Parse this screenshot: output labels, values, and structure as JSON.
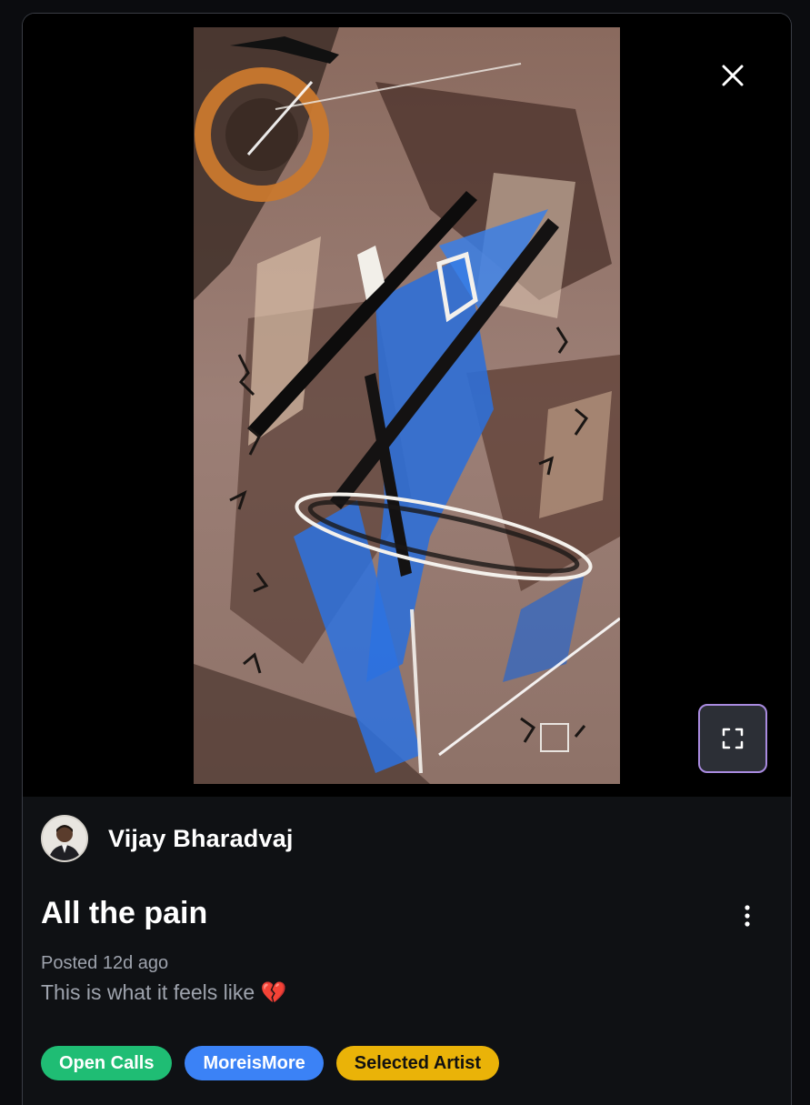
{
  "post": {
    "author_name": "Vijay Bharadvaj",
    "title": "All the pain",
    "posted": "Posted 12d ago",
    "description": "This is what it feels like 💔"
  },
  "icons": {
    "close": "close-icon",
    "expand": "fullscreen-icon",
    "more": "more-vertical-icon",
    "avatar": "avatar-photo"
  },
  "tags": [
    {
      "label": "Open Calls",
      "bg": "#1fbd74",
      "fg": "#ffffff"
    },
    {
      "label": "MoreisMore",
      "bg": "#3b82f6",
      "fg": "#ffffff"
    },
    {
      "label": "Selected Artist",
      "bg": "#eab308",
      "fg": "#111111"
    }
  ],
  "colors": {
    "card_bg": "#000000",
    "details_bg": "#0f1114",
    "expand_border": "#a98be0",
    "expand_bg": "#2c2f36",
    "muted_text": "#9ea3ad"
  }
}
